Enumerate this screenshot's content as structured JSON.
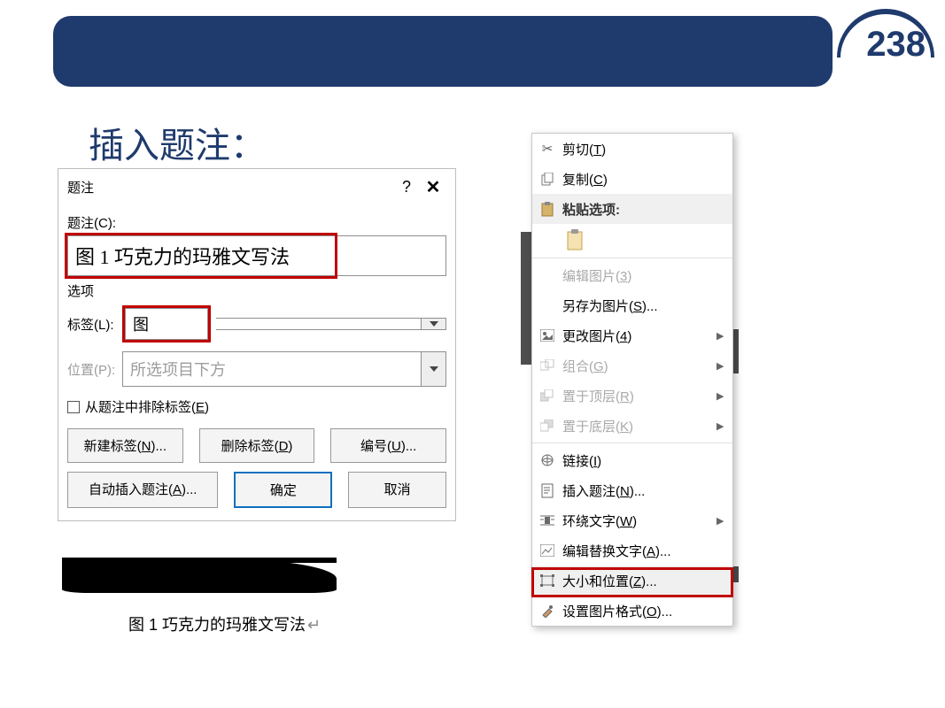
{
  "pageNumber": "238",
  "slideTitle": "插入题注：",
  "dialog": {
    "title": "题注",
    "captionLabel": "题注(C):",
    "captionValue": "图 1 巧克力的玛雅文写法",
    "optionsHeader": "选项",
    "labelLabel": "标签(L):",
    "labelValue": "图",
    "positionLabel": "位置(P):",
    "positionValue": "所选项目下方",
    "excludeLabel": "从题注中排除标签(E)",
    "newLabelBtn": "新建标签(N)...",
    "deleteLabelBtn": "删除标签(D)",
    "numberingBtn": "编号(U)...",
    "autoCaptionBtn": "自动插入题注(A)...",
    "okBtn": "确定",
    "cancelBtn": "取消"
  },
  "example": {
    "text": "图 1 巧克力的玛雅文写法"
  },
  "contextMenu": {
    "cut": "剪切(T)",
    "copy": "复制(C)",
    "pasteOptions": "粘贴选项:",
    "editPicture": "编辑图片(3)",
    "saveAsPicture": "另存为图片(S)...",
    "changePicture": "更改图片(4)",
    "group": "组合(G)",
    "bringToFront": "置于顶层(R)",
    "sendToBack": "置于底层(K)",
    "link": "链接(I)",
    "insertCaption": "插入题注(N)...",
    "wrapText": "环绕文字(W)",
    "editAltText": "编辑替换文字(A)...",
    "sizeAndPosition": "大小和位置(Z)...",
    "formatPicture": "设置图片格式(O)..."
  }
}
